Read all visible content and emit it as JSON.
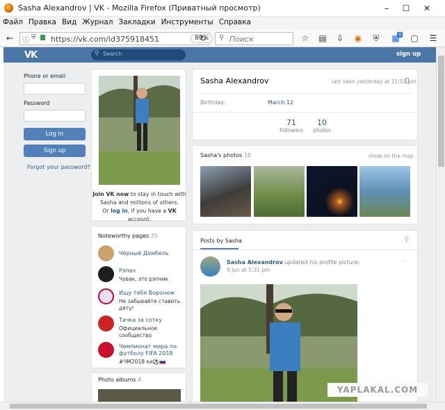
{
  "window": {
    "title": "Sasha Alexandrov | VK - Mozilla Firefox (Приватный просмотр)",
    "minimize": "–",
    "maximize": "☐",
    "close": "✕"
  },
  "menu": [
    "Файл",
    "Правка",
    "Вид",
    "Журнал",
    "Закладки",
    "Инструменты",
    "Справка"
  ],
  "nav": {
    "url": "https://vk.com/id375918451",
    "zoom": "80%",
    "search_placeholder": "Поиск",
    "badge": "0"
  },
  "vk_header": {
    "logo": "VK",
    "search_placeholder": "Search",
    "signup": "sign up"
  },
  "login": {
    "phone_label": "Phone or email",
    "password_label": "Password",
    "login_button": "Log in",
    "signup_button": "Sign up",
    "forgot": "Forgot your password?"
  },
  "join": {
    "line1_bold": "Join VK now",
    "line1_rest": " to stay in touch with",
    "line2": "Sasha and millions of others.",
    "line3_pre": "Or ",
    "line3_link": "log in",
    "line3_mid": ", if you have a ",
    "line3_bold": "VK",
    "line3_end": " account."
  },
  "profile": {
    "name": "Sasha Alexandrov",
    "last_seen": "last seen yesterday at 11:57 pm",
    "birthday_label": "Birthday:",
    "birthday_value": "March 12",
    "followers_count": "71",
    "followers_label": "followers",
    "photos_count": "10",
    "photos_label": "photos"
  },
  "photos_block": {
    "title": "Sasha's photos",
    "count": "10",
    "map_link": "show on the map"
  },
  "noteworthy": {
    "title": "Noteworthy pages",
    "count": "35",
    "items": [
      {
        "name": "Чёрный Дембель",
        "desc": ""
      },
      {
        "name": "Рэпач",
        "desc": "Чувак, это рэпчик"
      },
      {
        "name": "Ищу тебя Воронеж",
        "desc": "Не забывайте ставить дяту!"
      },
      {
        "name": "Тачка за сотку",
        "desc": "Официальное сообщество"
      },
      {
        "name": "Чемпионат мира по футболу FIFA 2018",
        "desc": "#ЧМ2018 ки⚽🇷🇺"
      }
    ]
  },
  "albums": {
    "title": "Photo albums",
    "count": "4"
  },
  "posts": {
    "tab": "Posts by Sasha",
    "author": "Sasha Alexandrov",
    "action": " updated his profile picture:",
    "time": "9 Jun at 5:31 pm",
    "more": "···"
  },
  "watermark": "YAPLAKAL.COM"
}
